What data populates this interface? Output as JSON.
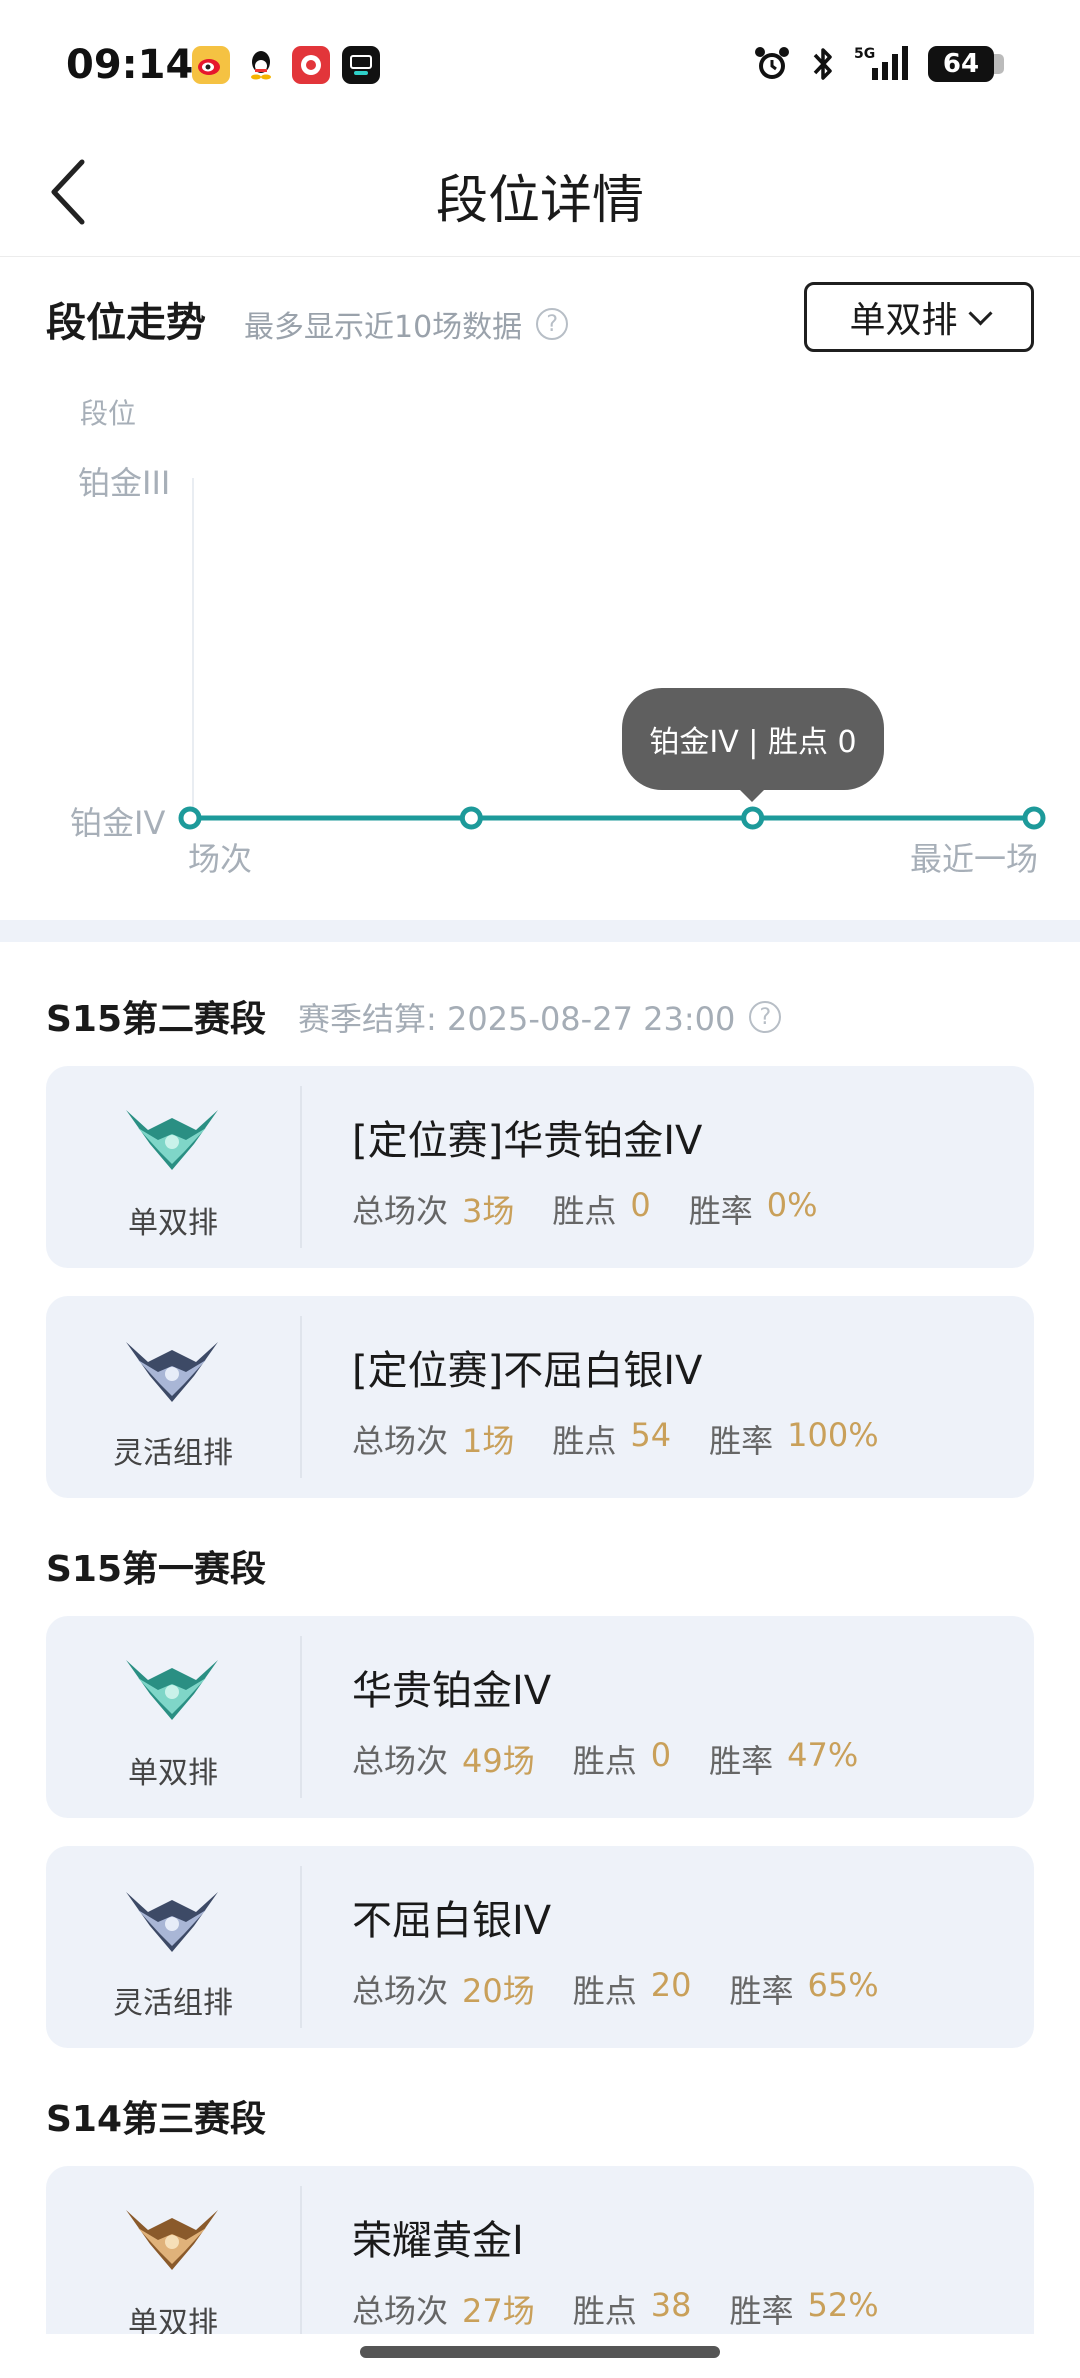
{
  "status_bar": {
    "time": "09:14",
    "apps": [
      {
        "icon": "weibo-icon",
        "color": "#f5c242"
      },
      {
        "icon": "qq-icon",
        "color": "#ffffff"
      },
      {
        "icon": "news-app-icon",
        "color": "#e2353a"
      },
      {
        "icon": "dewu-icon",
        "color": "#111111"
      }
    ],
    "network": "5G",
    "battery": "64"
  },
  "header": {
    "title": "段位详情"
  },
  "trend": {
    "title": "段位走势",
    "subtitle": "最多显示近10场数据",
    "mode": "单双排"
  },
  "chart_data": {
    "type": "line",
    "ylabel": "段位",
    "y_ticks": [
      "铂金IV",
      "铂金III"
    ],
    "xlabel_start": "场次",
    "xlabel_end": "最近一场",
    "series": [
      {
        "values": [
          "铂金IV",
          "铂金IV",
          "铂金IV",
          "铂金IV"
        ]
      }
    ],
    "tooltip": "铂金IV | 胜点 0",
    "color": "#1d9a9a"
  },
  "labels": {
    "games": "总场次",
    "points": "胜点",
    "winrate": "胜率"
  },
  "seasons": [
    {
      "title": "S15第二赛段",
      "note": "赛季结算: 2025-08-27 23:00",
      "cards": [
        {
          "queue": "单双排",
          "rank": "[定位赛]华贵铂金IV",
          "games": "3场",
          "points": "0",
          "winrate": "0%",
          "tier": "platinum"
        },
        {
          "queue": "灵活组排",
          "rank": "[定位赛]不屈白银IV",
          "games": "1场",
          "points": "54",
          "winrate": "100%",
          "tier": "silver"
        }
      ]
    },
    {
      "title": "S15第一赛段",
      "cards": [
        {
          "queue": "单双排",
          "rank": "华贵铂金IV",
          "games": "49场",
          "points": "0",
          "winrate": "47%",
          "tier": "platinum"
        },
        {
          "queue": "灵活组排",
          "rank": "不屈白银IV",
          "games": "20场",
          "points": "20",
          "winrate": "65%",
          "tier": "silver"
        }
      ]
    },
    {
      "title": "S14第三赛段",
      "cards": [
        {
          "queue": "单双排",
          "rank": "荣耀黄金I",
          "games": "27场",
          "points": "38",
          "winrate": "52%",
          "tier": "gold"
        }
      ]
    }
  ]
}
